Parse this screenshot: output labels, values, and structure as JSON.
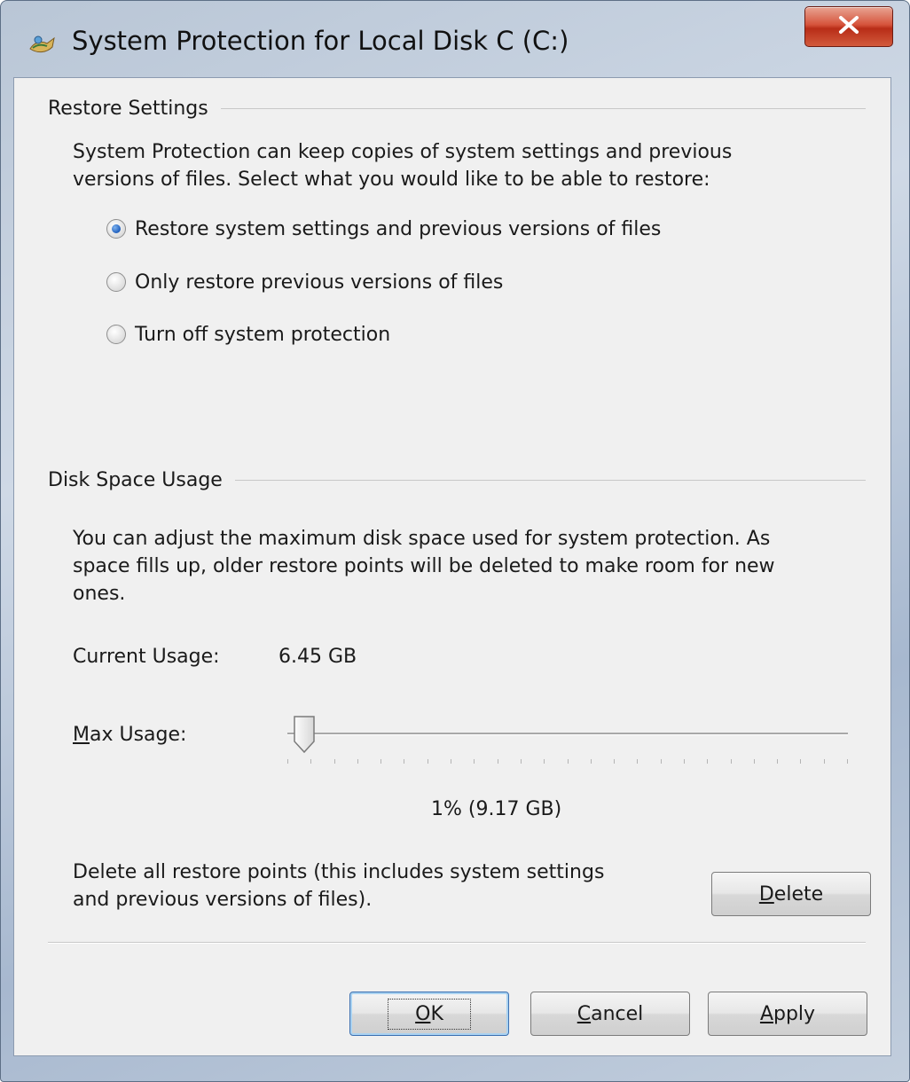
{
  "window": {
    "title": "System Protection for Local Disk C (C:)",
    "title_icon": "system-protection-icon",
    "close_icon": "close-icon"
  },
  "restore_settings": {
    "header": "Restore Settings",
    "description_line1": "System Protection can keep copies of system settings and previous",
    "description_line2": "versions of files. Select what you would like to be able to restore:",
    "options": [
      {
        "label": "Restore system settings and previous versions of files",
        "checked": true
      },
      {
        "label": "Only restore previous versions of files",
        "checked": false
      },
      {
        "label": "Turn off system protection",
        "checked": false
      }
    ]
  },
  "disk_space": {
    "header": "Disk Space Usage",
    "description_line1": "You can adjust the maximum disk space used for system protection. As",
    "description_line2": "space fills up, older restore points will be deleted to make room for new",
    "description_line3": "ones.",
    "current_usage_label": "Current Usage:",
    "current_usage_value": "6.45 GB",
    "max_usage_label": "Max Usage:",
    "max_usage_accesskey": "M",
    "max_usage_label_rest": "ax Usage:",
    "slider_percent": 1,
    "max_usage_value": "1% (9.17 GB)",
    "delete_text_line1": "Delete all restore points (this includes system settings",
    "delete_text_line2": "and previous versions of files).",
    "delete_button": {
      "accesskey": "D",
      "rest": "elete",
      "label": "Delete"
    }
  },
  "buttons": {
    "ok": {
      "accesskey": "O",
      "rest": "K",
      "label": "OK"
    },
    "cancel": {
      "accesskey": "C",
      "rest": "ancel",
      "label": "Cancel"
    },
    "apply": {
      "accesskey": "A",
      "rest": "pply",
      "label": "Apply"
    }
  },
  "colors": {
    "frame": "#b9c6d6",
    "client": "#f0f0f0",
    "close_button": "#c8442a",
    "radio_selected": "#1f5fbd",
    "default_button_border": "#3b6fb0"
  }
}
